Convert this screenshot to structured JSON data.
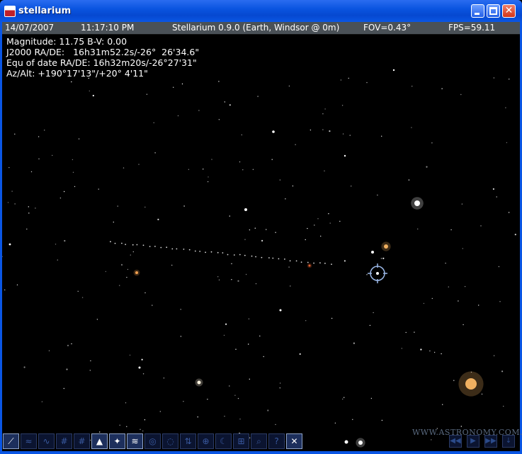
{
  "window": {
    "title": "stellarium",
    "minimize_label": "",
    "close_glyph": "✕"
  },
  "status": {
    "date": "14/07/2007",
    "time": "11:17:10 PM",
    "location": "Stellarium 0.9.0 (Earth, Windsor @ 0m)",
    "fov": "FOV=0.43°",
    "fps": "FPS=59.11"
  },
  "object_info": {
    "magnitude": "Magnitude: 11.75 B-V: 0.00",
    "j2000": "J2000 RA/DE:   16h31m52.2s/-26°  26'34.6\"",
    "equ_of_date": "Equ of date RA/DE: 16h32m20s/-26°27'31\"",
    "az_alt": "Az/Alt: +190°17'13\"/+20° 4'11\""
  },
  "toolbar": {
    "buttons": [
      {
        "icon": "constellation-lines-icon",
        "glyph": "⟋",
        "active": true
      },
      {
        "icon": "constellation-names-icon",
        "glyph": "≈",
        "active": false
      },
      {
        "icon": "constellation-art-icon",
        "glyph": "∿",
        "active": false
      },
      {
        "icon": "azimuthal-grid-icon",
        "glyph": "#",
        "active": false
      },
      {
        "icon": "equatorial-grid-icon",
        "glyph": "#",
        "active": false
      },
      {
        "icon": "ground-icon",
        "glyph": "▲",
        "active": true
      },
      {
        "icon": "cardinal-points-icon",
        "glyph": "✦",
        "active": true
      },
      {
        "icon": "atmosphere-icon",
        "glyph": "≋",
        "active": true
      },
      {
        "icon": "nebulae-icon",
        "glyph": "◎",
        "active": false
      },
      {
        "icon": "planet-hints-icon",
        "glyph": "◌",
        "active": false
      },
      {
        "icon": "mount-icon",
        "glyph": "⇅",
        "active": false
      },
      {
        "icon": "goto-icon",
        "glyph": "⊕",
        "active": false
      },
      {
        "icon": "night-mode-icon",
        "glyph": "☾",
        "active": false
      },
      {
        "icon": "fullscreen-icon",
        "glyph": "⊞",
        "active": false
      },
      {
        "icon": "search-icon",
        "glyph": "⌕",
        "active": false
      },
      {
        "icon": "help-icon",
        "glyph": "?",
        "active": false
      },
      {
        "icon": "quit-icon",
        "glyph": "✕",
        "active": true
      }
    ]
  },
  "time_controls": [
    {
      "icon": "rewind-icon",
      "glyph": "◀◀"
    },
    {
      "icon": "play-icon",
      "glyph": "▶"
    },
    {
      "icon": "fast-forward-icon",
      "glyph": "▶▶"
    },
    {
      "icon": "now-icon",
      "glyph": "↓"
    }
  ],
  "watermark": "WWW.ASTRONOMY.COM.CN",
  "colors": {
    "titlebar": "#0a56e4",
    "statusbar": "#4a5157",
    "sky": "#000000",
    "star_orange": "#f0b060",
    "selection_reticle": "#9bb8e8"
  }
}
